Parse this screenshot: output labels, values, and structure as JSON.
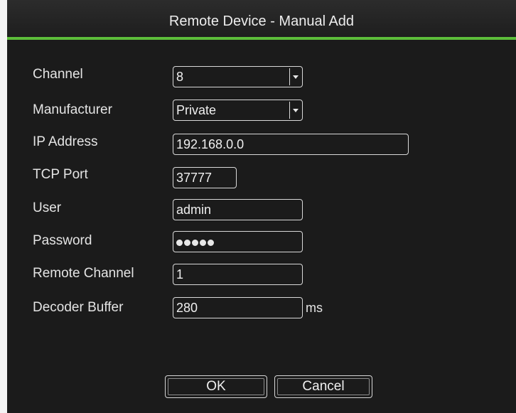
{
  "dialog": {
    "title": "Remote Device - Manual Add"
  },
  "form": {
    "channel": {
      "label": "Channel",
      "value": "8"
    },
    "manufacturer": {
      "label": "Manufacturer",
      "value": "Private"
    },
    "ip_address": {
      "label": "IP Address",
      "value": "192.168.0.0"
    },
    "tcp_port": {
      "label": "TCP Port",
      "value": "37777"
    },
    "user": {
      "label": "User",
      "value": "admin"
    },
    "password": {
      "label": "Password",
      "masked_length": 5
    },
    "remote_channel": {
      "label": "Remote Channel",
      "value": "1"
    },
    "decoder_buffer": {
      "label": "Decoder Buffer",
      "value": "280",
      "unit": "ms"
    }
  },
  "buttons": {
    "ok": "OK",
    "cancel": "Cancel"
  },
  "icons": {
    "dropdown": "chevron-down-icon"
  },
  "colors": {
    "background": "#1b1b1b",
    "title_rule": "#5cbd3a",
    "text": "#e4e4e4",
    "border": "#d9d9d9"
  }
}
